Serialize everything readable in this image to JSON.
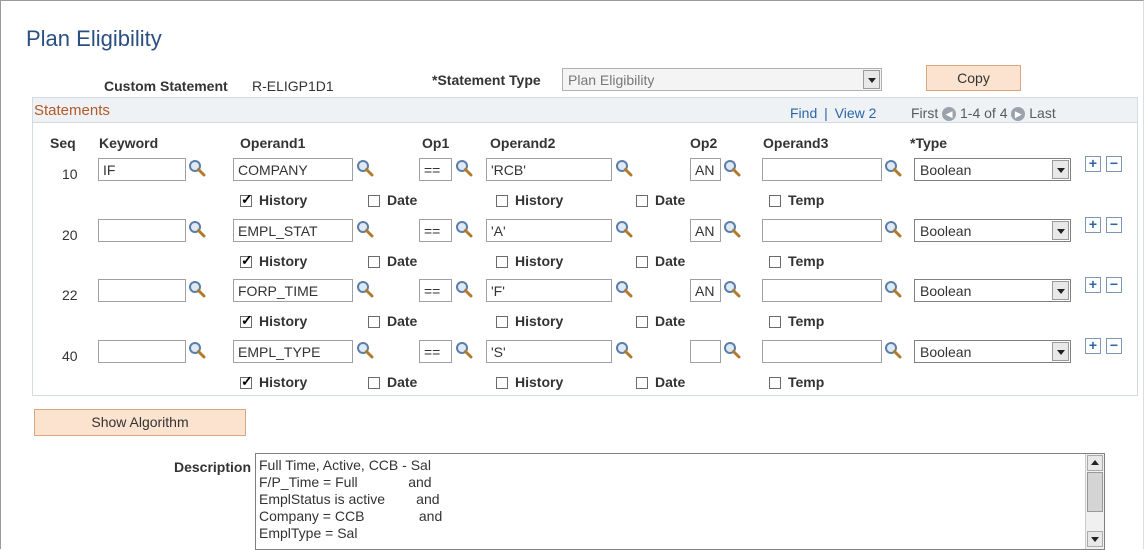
{
  "page": {
    "title": "Plan Eligibility"
  },
  "header": {
    "custom_statement_label": "Custom Statement",
    "custom_statement_value": "R-ELIGP1D1",
    "statement_type_label": "*Statement Type",
    "statement_type_value": "Plan Eligibility",
    "copy_button": "Copy"
  },
  "grid": {
    "title": "Statements",
    "find": "Find",
    "separator": "|",
    "view": "View 2",
    "first": "First",
    "range": "1-4 of 4",
    "last": "Last",
    "columns": {
      "seq": "Seq",
      "keyword": "Keyword",
      "operand1": "Operand1",
      "op1": "Op1",
      "operand2": "Operand2",
      "op2": "Op2",
      "operand3": "Operand3",
      "type": "*Type"
    },
    "checkbox_labels": {
      "history": "History",
      "date": "Date",
      "history2": "History",
      "date2": "Date",
      "temp": "Temp"
    },
    "add_symbol": "+",
    "remove_symbol": "−",
    "rows": [
      {
        "seq": "10",
        "keyword": "IF",
        "operand1": "COMPANY",
        "op1": "==",
        "operand2": "'RCB'",
        "op2": "AN",
        "operand3": "",
        "type": "Boolean",
        "history": true,
        "date": false,
        "history2": false,
        "date2": false,
        "temp": false
      },
      {
        "seq": "20",
        "keyword": "",
        "operand1": "EMPL_STAT",
        "op1": "==",
        "operand2": "'A'",
        "op2": "AN",
        "operand3": "",
        "type": "Boolean",
        "history": true,
        "date": false,
        "history2": false,
        "date2": false,
        "temp": false
      },
      {
        "seq": "22",
        "keyword": "",
        "operand1": "FORP_TIME",
        "op1": "==",
        "operand2": "'F'",
        "op2": "AN",
        "operand3": "",
        "type": "Boolean",
        "history": true,
        "date": false,
        "history2": false,
        "date2": false,
        "temp": false
      },
      {
        "seq": "40",
        "keyword": "",
        "operand1": "EMPL_TYPE",
        "op1": "==",
        "operand2": "'S'",
        "op2": "",
        "operand3": "",
        "type": "Boolean",
        "history": true,
        "date": false,
        "history2": false,
        "date2": false,
        "temp": false
      }
    ]
  },
  "show_algorithm_button": "Show Algorithm",
  "description": {
    "label": "Description",
    "text": "Full Time, Active, CCB - Sal\nF/P_Time = Full             and\nEmplStatus is active        and\nCompany = CCB              and\nEmplType = Sal"
  },
  "colors": {
    "title": "#2b4f80",
    "grid_title": "#b4582a",
    "link": "#2b65a8",
    "button_bg": "#fbe3cf"
  },
  "icons": {
    "lookup": "magnifier-icon",
    "prev": "prev-circle-icon",
    "next": "next-circle-icon"
  }
}
